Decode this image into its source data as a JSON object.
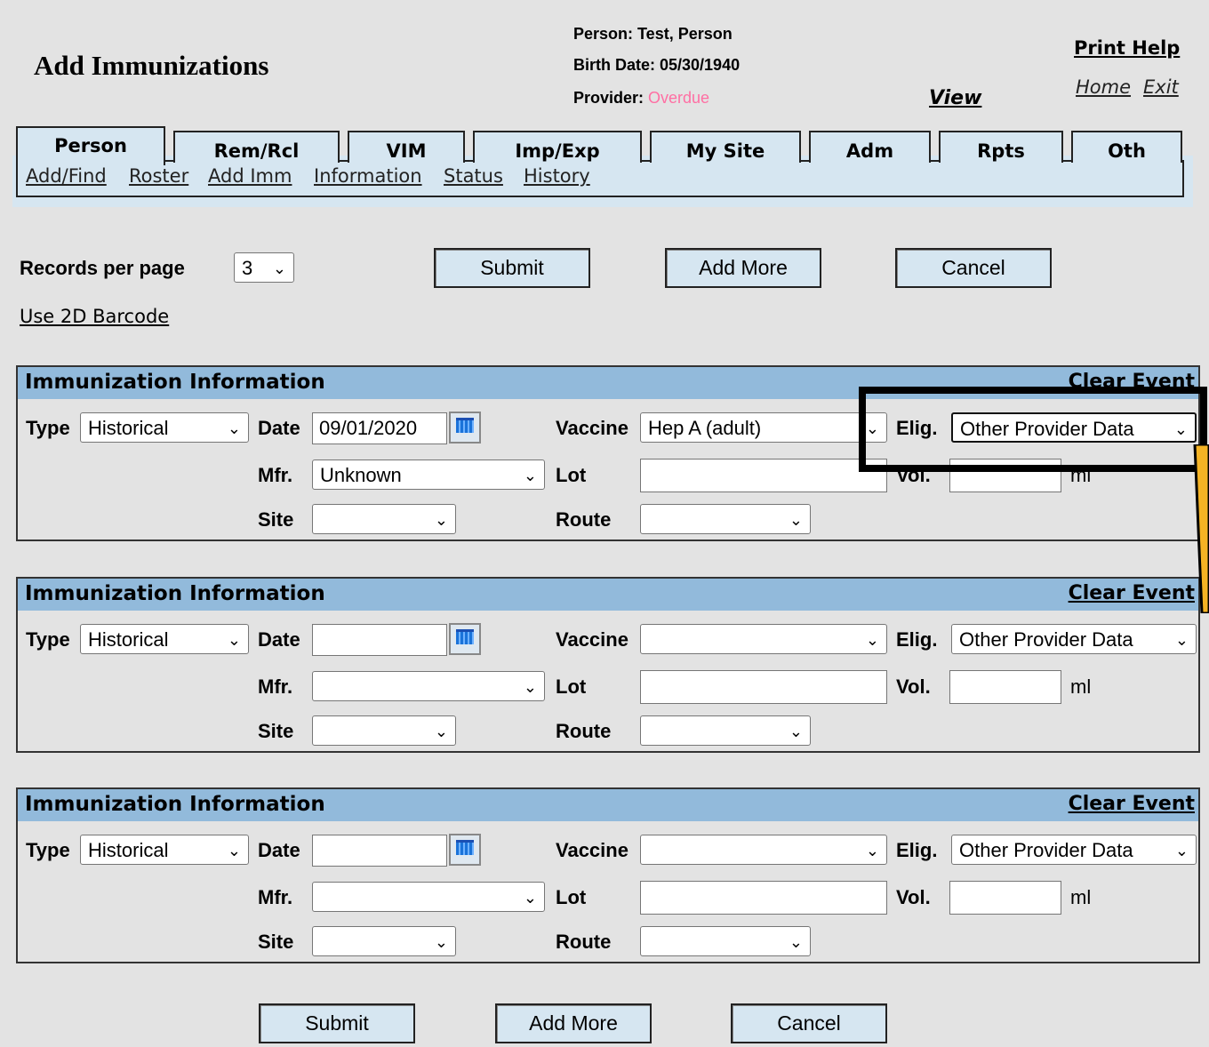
{
  "header": {
    "title": "Add Immunizations",
    "person_label": "Person: Test, Person",
    "birth_label": "Birth Date: 05/30/1940",
    "provider_label": "Provider: ",
    "provider_status": "Overdue",
    "view": "View",
    "print_help": "Print Help",
    "home": "Home",
    "exit": "Exit"
  },
  "tabs": [
    "Person",
    "Rem/Rcl",
    "VIM",
    "Imp/Exp",
    "My Site",
    "Adm",
    "Rpts",
    "Oth"
  ],
  "subnav": [
    "Add/Find",
    "Roster",
    "Add Imm",
    "Information",
    "Status",
    "History"
  ],
  "controls": {
    "records_label": "Records per page",
    "records_value": "3",
    "submit": "Submit",
    "add_more": "Add More",
    "cancel": "Cancel",
    "barcode": "Use 2D Barcode"
  },
  "labels": {
    "type": "Type",
    "date": "Date",
    "vaccine": "Vaccine",
    "elig": "Elig.",
    "mfr": "Mfr.",
    "lot": "Lot",
    "vol": "Vol.",
    "site": "Site",
    "route": "Route",
    "ml": "ml"
  },
  "panels": [
    {
      "title": "Immunization Information",
      "clear": "Clear Event",
      "type": "Historical",
      "date": "09/01/2020",
      "vaccine": "Hep A (adult)",
      "elig": "Other Provider Data",
      "mfr": "Unknown",
      "lot": "",
      "vol": "",
      "site": "",
      "route": ""
    },
    {
      "title": "Immunization Information",
      "clear": "Clear Event",
      "type": "Historical",
      "date": "",
      "vaccine": "",
      "elig": "Other Provider Data",
      "mfr": "",
      "lot": "",
      "vol": "",
      "site": "",
      "route": ""
    },
    {
      "title": "Immunization Information",
      "clear": "Clear Event",
      "type": "Historical",
      "date": "",
      "vaccine": "",
      "elig": "Other Provider Data",
      "mfr": "",
      "lot": "",
      "vol": "",
      "site": "",
      "route": ""
    }
  ],
  "colors": {
    "accent": "#92badb",
    "tab_bg": "#d6e6f1",
    "overdue": "#ff6fa3",
    "highlight_arrow": "#f5b324"
  }
}
